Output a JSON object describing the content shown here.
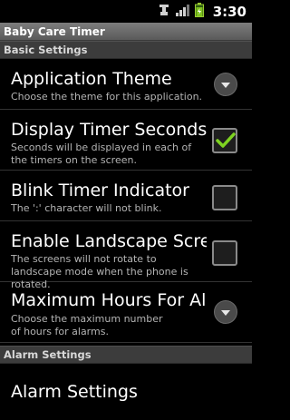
{
  "status_bar": {
    "time": "3:30"
  },
  "app_title": "Baby Care Timer",
  "sections": {
    "basic": "Basic Settings",
    "alarm": "Alarm Settings"
  },
  "prefs": {
    "theme": {
      "title": "Application Theme",
      "summary": "Choose the theme for this application."
    },
    "seconds": {
      "title": "Display Timer Seconds",
      "summary": "Seconds will be displayed in each of the timers on the screen.",
      "checked": true
    },
    "blink": {
      "title": "Blink Timer Indicator",
      "summary": "The ':' character will not blink.",
      "checked": false
    },
    "landscape": {
      "title": "Enable Landscape Screen",
      "summary": "The screens will not rotate to landscape mode when the phone is rotated.",
      "checked": false
    },
    "max_hours": {
      "title": "Maximum Hours For Alarms",
      "summary": "Choose the maximum number of hours for alarms."
    },
    "alarm_settings": {
      "title": "Alarm Settings"
    }
  },
  "colors": {
    "check_green": "#7ed321",
    "background": "#000000"
  }
}
